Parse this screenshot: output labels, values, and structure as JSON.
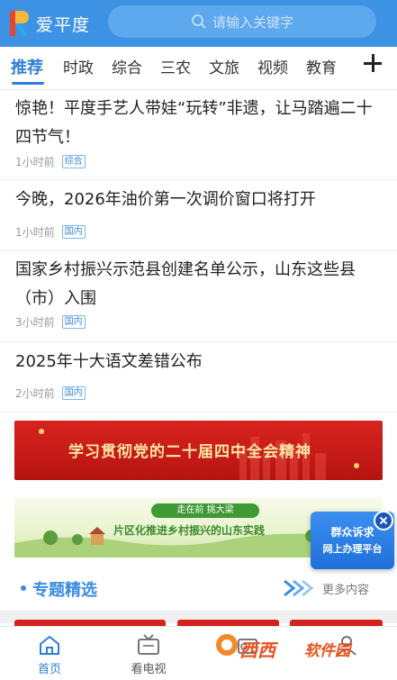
{
  "header": {
    "app_name": "爱平度",
    "search_placeholder": "请输入关键字",
    "accent_color": "#3d92e3"
  },
  "tabs": [
    {
      "label": "推荐",
      "active": true
    },
    {
      "label": "时政",
      "active": false
    },
    {
      "label": "综合",
      "active": false
    },
    {
      "label": "三农",
      "active": false
    },
    {
      "label": "文旅",
      "active": false
    },
    {
      "label": "视频",
      "active": false
    },
    {
      "label": "教育",
      "active": false
    }
  ],
  "add_tab_icon": "plus-icon",
  "news": [
    {
      "title": "惊艳！平度手艺人带娃“玩转”非遗，让马踏遍二十四节气！",
      "time": "1小时前",
      "tag": "综合"
    },
    {
      "title": "今晚，2026年油价第一次调价窗口将打开",
      "time": "1小时前",
      "tag": "国内"
    },
    {
      "title": "国家乡村振兴示范县创建名单公示，山东这些县（市）入围",
      "time": "3小时前",
      "tag": "国内"
    },
    {
      "title": "2025年十大语文差错公布",
      "time": "2小时前",
      "tag": "国内"
    }
  ],
  "banners": {
    "red_text": "学习贯彻党的二十届四中全会精神",
    "green_badge": "走在前 挑大梁",
    "green_text": "片区化推进乡村振兴的山东实践"
  },
  "float_widget": {
    "line1": "群众诉求",
    "line2": "网上办理平台"
  },
  "section": {
    "title": "专题精选",
    "more": "更多内容"
  },
  "bottom_nav": [
    {
      "label": "首页",
      "icon": "home-icon",
      "active": true
    },
    {
      "label": "看电视",
      "icon": "tv-icon",
      "active": false
    },
    {
      "label": "",
      "icon": "radio-icon",
      "active": false
    },
    {
      "label": "",
      "icon": "user-icon",
      "active": false
    }
  ],
  "watermark": {
    "part1": "西西",
    "part2": "软件园"
  }
}
